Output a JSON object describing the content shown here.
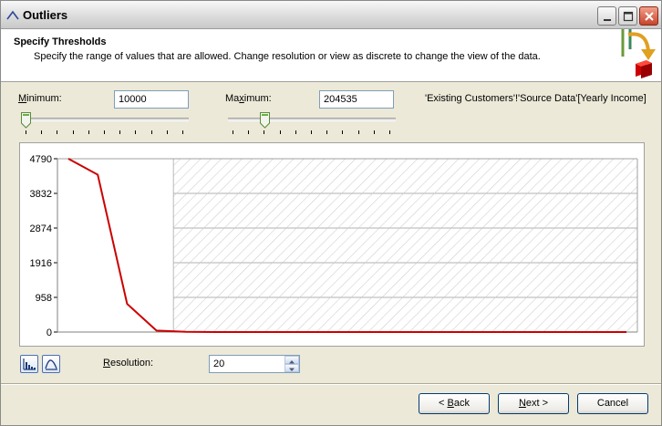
{
  "window": {
    "title": "Outliers"
  },
  "header": {
    "title": "Specify Thresholds",
    "description": "Specify the range of values that are allowed.  Change resolution or view as discrete to change the view of the data."
  },
  "minimum": {
    "label_pre": "",
    "label_key": "M",
    "label_post": "inimum:",
    "value": "10000",
    "slider_fraction": 0.0
  },
  "maximum": {
    "label_pre": "Ma",
    "label_key": "x",
    "label_post": "imum:",
    "value": "204535",
    "slider_fraction": 0.2
  },
  "source_column": "'Existing Customers'!'Source Data'[Yearly Income]",
  "resolution": {
    "label_pre": "",
    "label_key": "R",
    "label_post": "esolution:",
    "value": "20"
  },
  "view_buttons": {
    "histogram_icon": "bar-chart-icon",
    "curve_icon": "curve-chart-icon"
  },
  "buttons": {
    "back_pre": "< ",
    "back_key": "B",
    "back_post": "ack",
    "next_pre": "",
    "next_key": "N",
    "next_post": "ext >",
    "cancel": "Cancel"
  },
  "colors": {
    "line": "#cc0000",
    "hatch": "#c8c8c8",
    "grid": "#b0b0b0"
  },
  "chart_data": {
    "type": "line",
    "y_ticks": [
      "4790",
      "3832",
      "2874",
      "1916",
      "958",
      "0"
    ],
    "ylim": [
      0,
      4790
    ],
    "x": [
      0,
      1,
      2,
      3,
      4,
      5,
      6,
      7,
      8,
      9,
      10,
      11,
      12,
      13,
      14,
      15,
      16,
      17,
      18,
      19
    ],
    "values": [
      4790,
      4350,
      780,
      40,
      5,
      0,
      0,
      0,
      0,
      0,
      0,
      0,
      0,
      0,
      0,
      0,
      0,
      0,
      0,
      0
    ],
    "allowed_bins": [
      0,
      1,
      2,
      3
    ],
    "excluded_region": "hatched"
  }
}
